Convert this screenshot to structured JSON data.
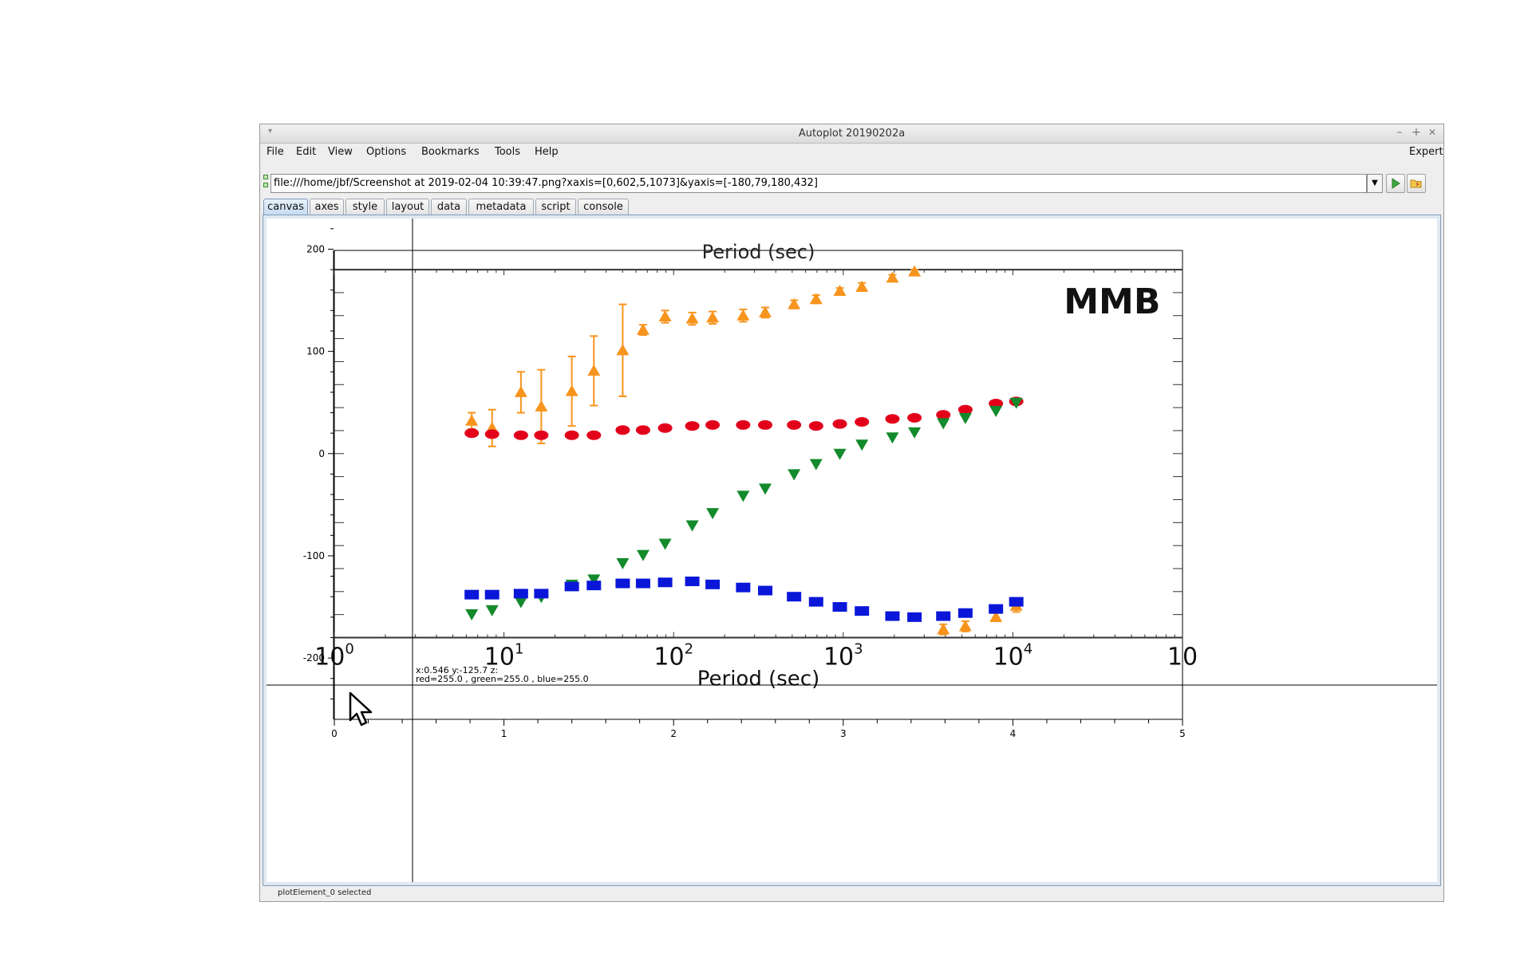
{
  "window": {
    "title": "Autoplot 20190202a",
    "controls": {
      "minimize_icon": "–",
      "maximize_icon": "+",
      "close_icon": "✕"
    },
    "system_menu_icon": "▾"
  },
  "menubar": {
    "items": [
      "File",
      "Edit",
      "View",
      "Options",
      "Bookmarks",
      "Tools",
      "Help"
    ],
    "right_label": "Expert"
  },
  "url_bar": {
    "value": "file:///home/jbf/Screenshot at 2019-02-04 10:39:47.png?xaxis=[0,602,5,1073]&yaxis=[-180,79,180,432]",
    "dropdown_icon": "▼",
    "go_icon": "play-icon",
    "browse_icon": "folder-icon"
  },
  "tabs": {
    "items": [
      "canvas",
      "axes",
      "style",
      "layout",
      "data",
      "metadata",
      "script",
      "console"
    ],
    "active": "canvas"
  },
  "status": {
    "text": "plotElement_0 selected"
  },
  "crosshair_readout": {
    "line1": "x:0.546  y:-125.7  z:",
    "line2": "red=255.0 , green=255.0 , blue=255.0"
  },
  "chart_data": {
    "type": "scatter",
    "xlim": [
      0,
      5
    ],
    "ylim": [
      -260,
      230
    ],
    "x_ticks": [
      "0",
      "1",
      "2",
      "3",
      "4",
      "5"
    ],
    "y_ticks": [
      "200",
      "100",
      "0",
      "-100",
      "-200"
    ],
    "grid": false,
    "image": {
      "top_axis_label": "Period (sec)",
      "bottom_axis_label": "Period (sec)",
      "annotation": "MMB",
      "bottom_tick_labels": [
        {
          "base": "10",
          "exp": "0",
          "x": 0
        },
        {
          "base": "10",
          "exp": "1",
          "x": 1
        },
        {
          "base": "10",
          "exp": "2",
          "x": 2
        },
        {
          "base": "10",
          "exp": "3",
          "x": 3
        },
        {
          "base": "10",
          "exp": "4",
          "x": 4
        },
        {
          "base": "10",
          "exp": "",
          "x": 5
        }
      ],
      "frame_y": [
        -180,
        180
      ],
      "colors": {
        "orange": "#f7941d",
        "red": "#e3001b",
        "green": "#138a2b",
        "blue": "#0a17d8"
      }
    },
    "series": [
      {
        "color": "orange",
        "marker": "triangle-up",
        "points": [
          [
            0.81,
            32,
            8
          ],
          [
            0.93,
            25,
            18
          ],
          [
            1.1,
            60,
            20
          ],
          [
            1.22,
            46,
            36
          ],
          [
            1.4,
            61,
            34
          ],
          [
            1.53,
            81,
            34
          ],
          [
            1.7,
            101,
            45
          ],
          [
            1.82,
            121,
            5
          ],
          [
            1.95,
            134,
            6
          ],
          [
            2.11,
            132,
            6
          ],
          [
            2.23,
            133,
            6
          ],
          [
            2.41,
            135,
            6
          ],
          [
            2.54,
            138,
            5
          ],
          [
            2.71,
            146,
            4
          ],
          [
            2.84,
            151,
            4
          ],
          [
            2.98,
            159,
            3
          ],
          [
            3.11,
            163,
            4
          ],
          [
            3.29,
            172,
            3
          ],
          [
            3.42,
            178,
            2
          ],
          [
            3.59,
            -172,
            5
          ],
          [
            3.72,
            -169,
            5
          ],
          [
            3.9,
            -160,
            4
          ],
          [
            4.02,
            -149,
            6
          ]
        ]
      },
      {
        "color": "red",
        "marker": "circle",
        "points": [
          [
            0.81,
            20
          ],
          [
            0.93,
            19
          ],
          [
            1.1,
            18
          ],
          [
            1.22,
            18
          ],
          [
            1.4,
            18
          ],
          [
            1.53,
            18
          ],
          [
            1.7,
            23
          ],
          [
            1.82,
            23
          ],
          [
            1.95,
            25
          ],
          [
            2.11,
            27
          ],
          [
            2.23,
            28
          ],
          [
            2.41,
            28
          ],
          [
            2.54,
            28
          ],
          [
            2.71,
            28
          ],
          [
            2.84,
            27
          ],
          [
            2.98,
            29
          ],
          [
            3.11,
            31
          ],
          [
            3.29,
            34
          ],
          [
            3.42,
            35
          ],
          [
            3.59,
            38
          ],
          [
            3.72,
            43
          ],
          [
            3.9,
            49
          ],
          [
            4.02,
            51
          ]
        ]
      },
      {
        "color": "green",
        "marker": "triangle-down",
        "points": [
          [
            0.81,
            -157
          ],
          [
            0.93,
            -153
          ],
          [
            1.1,
            -145
          ],
          [
            1.22,
            -140
          ],
          [
            1.4,
            -128
          ],
          [
            1.53,
            -123
          ],
          [
            1.7,
            -107
          ],
          [
            1.82,
            -99
          ],
          [
            1.95,
            -88
          ],
          [
            2.11,
            -70
          ],
          [
            2.23,
            -58
          ],
          [
            2.41,
            -41
          ],
          [
            2.54,
            -34
          ],
          [
            2.71,
            -20
          ],
          [
            2.84,
            -10
          ],
          [
            2.98,
            0
          ],
          [
            3.11,
            9
          ],
          [
            3.29,
            16
          ],
          [
            3.42,
            21
          ],
          [
            3.59,
            30
          ],
          [
            3.72,
            35
          ],
          [
            3.9,
            42
          ],
          [
            4.02,
            50
          ]
        ]
      },
      {
        "color": "blue",
        "marker": "square",
        "points": [
          [
            0.81,
            -138
          ],
          [
            0.93,
            -138
          ],
          [
            1.1,
            -137
          ],
          [
            1.22,
            -137
          ],
          [
            1.4,
            -130
          ],
          [
            1.53,
            -129
          ],
          [
            1.7,
            -127
          ],
          [
            1.82,
            -127
          ],
          [
            1.95,
            -126
          ],
          [
            2.11,
            -125
          ],
          [
            2.23,
            -128
          ],
          [
            2.41,
            -131
          ],
          [
            2.54,
            -134
          ],
          [
            2.71,
            -140
          ],
          [
            2.84,
            -145
          ],
          [
            2.98,
            -150
          ],
          [
            3.11,
            -154
          ],
          [
            3.29,
            -159
          ],
          [
            3.42,
            -160
          ],
          [
            3.59,
            -159
          ],
          [
            3.72,
            -156
          ],
          [
            3.9,
            -152
          ],
          [
            4.02,
            -145
          ]
        ]
      }
    ]
  }
}
